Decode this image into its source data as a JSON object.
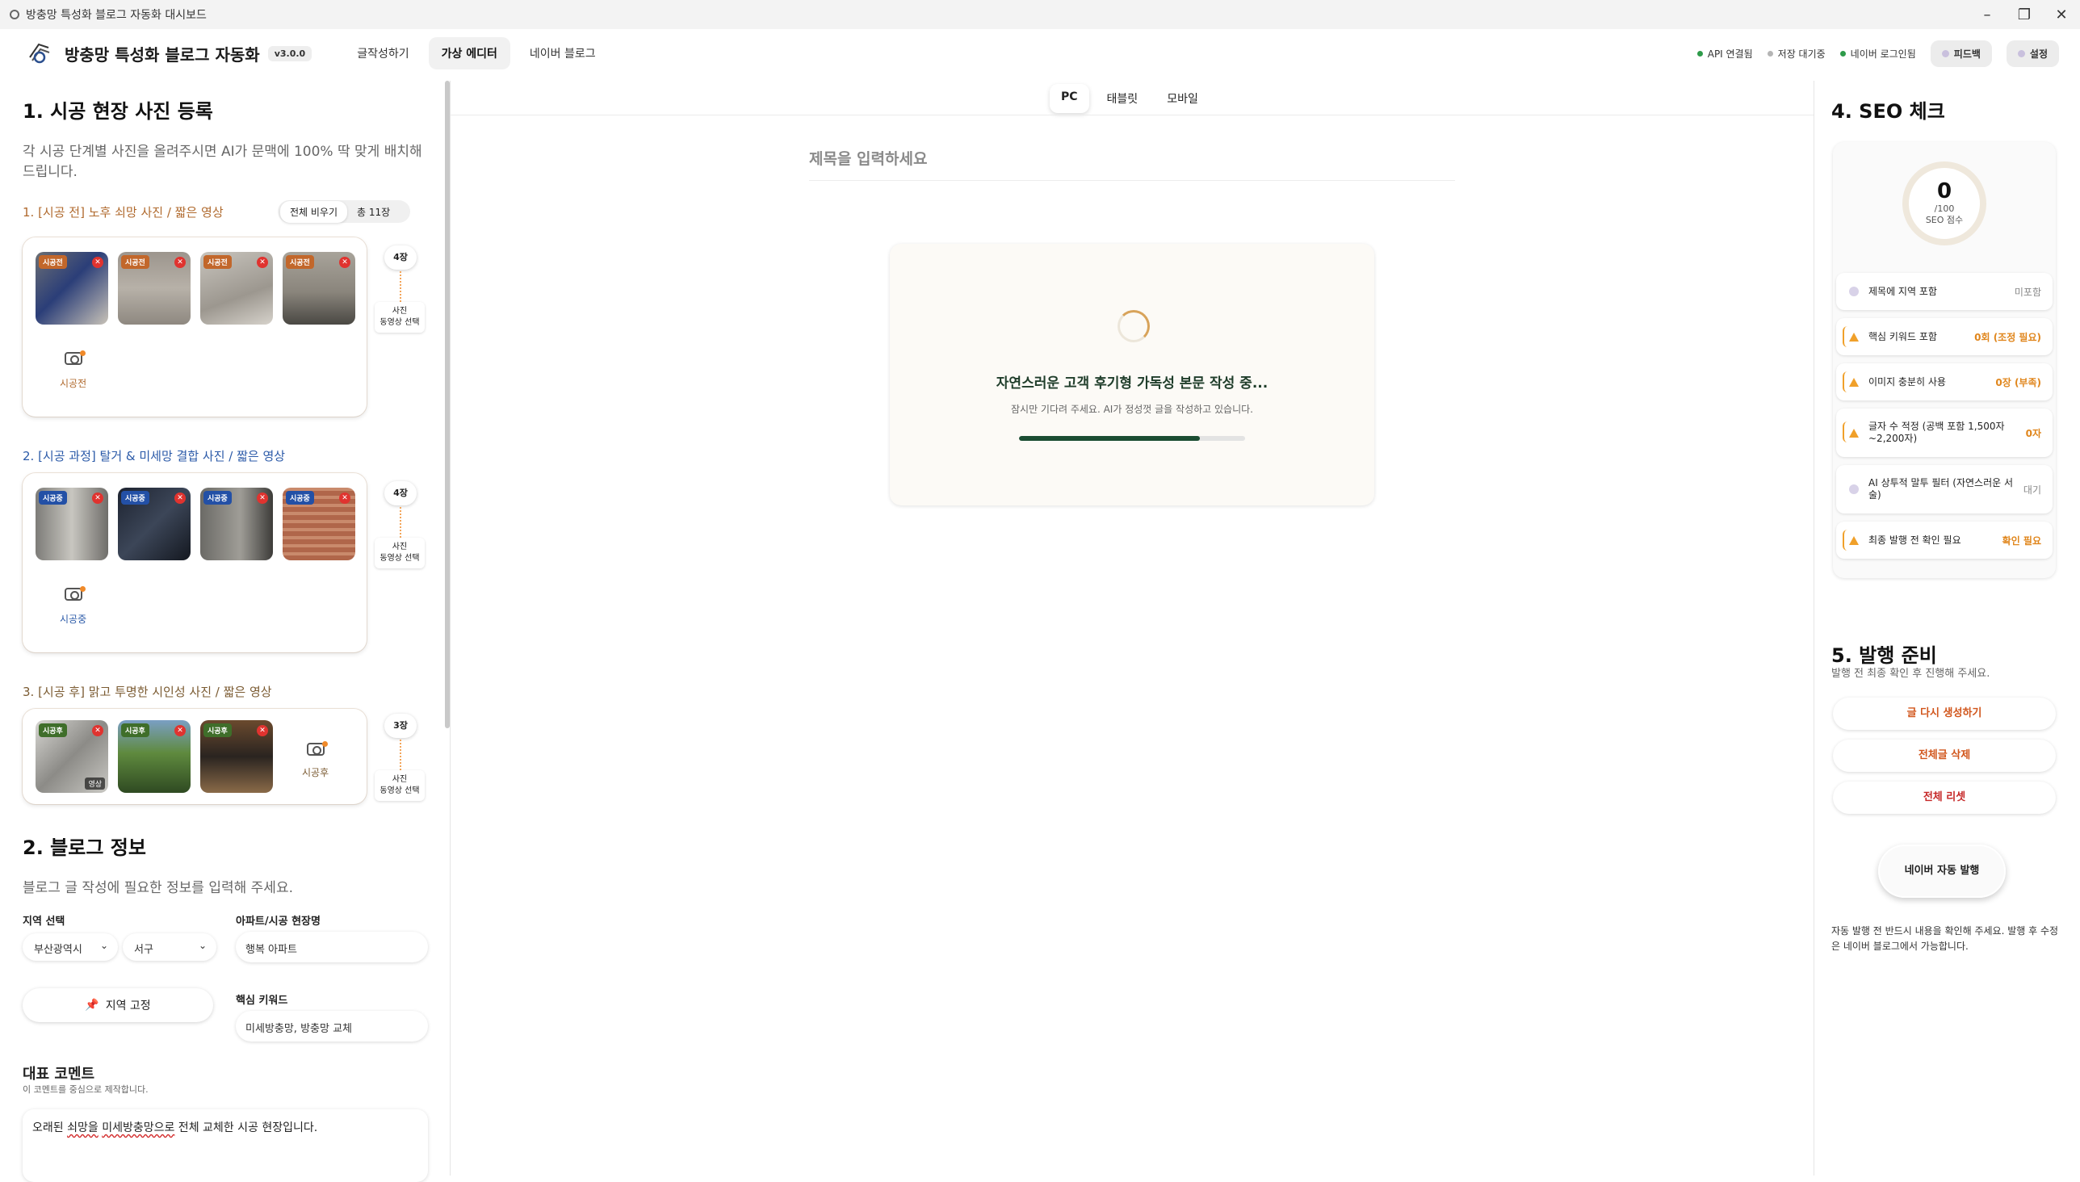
{
  "window": {
    "title": "방충망 특성화 블로그 자동화 대시보드",
    "minimize": "–",
    "maximize": "❐",
    "close": "✕"
  },
  "header": {
    "brand": "방충망 특성화 블로그 자동화",
    "version": "v3.0.0",
    "tabs": [
      "글작성하기",
      "가상 에디터",
      "네이버 블로그"
    ],
    "active_tab": "가상 에디터",
    "status": [
      {
        "label": "API 연결됨",
        "color": "#2e9b4a"
      },
      {
        "label": "저장 대기중",
        "color": "#b5b5b5"
      },
      {
        "label": "네이버 로그인됨",
        "color": "#2e9b4a"
      }
    ],
    "feedback_label": "피드백",
    "settings_label": "설정"
  },
  "left": {
    "section1_title": "1. 시공 현장 사진 등록",
    "section1_desc": "각 시공 단계별 사진을 올려주시면 AI가 문맥에 100% 딱 맞게 배치해 드립니다.",
    "toggle": {
      "clear_label": "전체 비우기",
      "total_label": "총 11장"
    },
    "groups": [
      {
        "label": "1. [시공 전] 노후 쇠망 사진 / 짧은 영상",
        "tag": "시공전",
        "count": "4장",
        "add_label": "시공전",
        "media_pick": [
          "사진",
          "동영상 선택"
        ]
      },
      {
        "label": "2. [시공 과정] 탈거 & 미세망 결합 사진 / 짧은 영상",
        "tag": "시공중",
        "count": "4장",
        "add_label": "시공중",
        "media_pick": [
          "사진",
          "동영상 선택"
        ]
      },
      {
        "label": "3. [시공 후] 맑고 투명한 시인성 사진 / 짧은 영상",
        "tag": "시공후",
        "count": "3장",
        "add_label": "시공후",
        "video_label": "영상",
        "media_pick": [
          "사진",
          "동영상 선택"
        ]
      }
    ],
    "section2_title": "2. 블로그 정보",
    "section2_desc": "블로그 글 작성에 필요한 정보를 입력해 주세요.",
    "region_label": "지역 선택",
    "region_city": "부산광역시",
    "region_district": "서구",
    "site_label": "아파트/시공 현장명",
    "site_value": "행복 아파트",
    "pin_label": "지역 고정",
    "keyword_label": "핵심 키워드",
    "keyword_value": "미세방충망, 방충망 교체",
    "comment_title": "대표 코멘트",
    "comment_desc": "이 코멘트를 중심으로 제작합니다.",
    "comment_text_a": "오래된 ",
    "comment_text_b": "쇠망을",
    "comment_text_c": " ",
    "comment_text_d": "미세방충망으로",
    "comment_text_e": " 전체 교체한 시공 현장입니다."
  },
  "center": {
    "view_tabs": [
      "PC",
      "태블릿",
      "모바일"
    ],
    "active_view": "PC",
    "title_placeholder": "제목을 입력하세요",
    "loading_title": "자연스러운 고객 후기형 가독성 본문 작성 중...",
    "loading_sub": "잠시만 기다려 주세요. AI가 정성껏 글을 작성하고 있습니다.",
    "progress": 0.8
  },
  "right": {
    "seo_title": "4. SEO 체크",
    "score": "0",
    "score_max": "/100",
    "score_label": "SEO 점수",
    "items": [
      {
        "name": "제목에 지역 포함",
        "value": "미포함",
        "state": "pending"
      },
      {
        "name": "핵심 키워드 포함",
        "value": "0회 (조정 필요)",
        "state": "warn"
      },
      {
        "name": "이미지 충분히 사용",
        "value": "0장 (부족)",
        "state": "warn"
      },
      {
        "name": "글자 수 적정 (공백 포함 1,500자~2,200자)",
        "value": "0자",
        "state": "warn"
      },
      {
        "name": "AI 상투적 말투 필터 (자연스러운 서술)",
        "value": "대기",
        "state": "pending"
      },
      {
        "name": "최종 발행 전 확인 필요",
        "value": "확인 필요",
        "state": "warn"
      }
    ],
    "publish_title": "5. 발행 준비",
    "publish_desc": "발행 전 최종 확인 후 진행해 주세요.",
    "regen_label": "글 다시 생성하기",
    "delete_label": "전체글 삭제",
    "reset_label": "전체 리셋",
    "naver_publish_label": "네이버 자동 발행",
    "note": "자동 발행 전 반드시 내용을 확인해 주세요. 발행 후 수정은 네이버 블로그에서 가능합니다."
  }
}
